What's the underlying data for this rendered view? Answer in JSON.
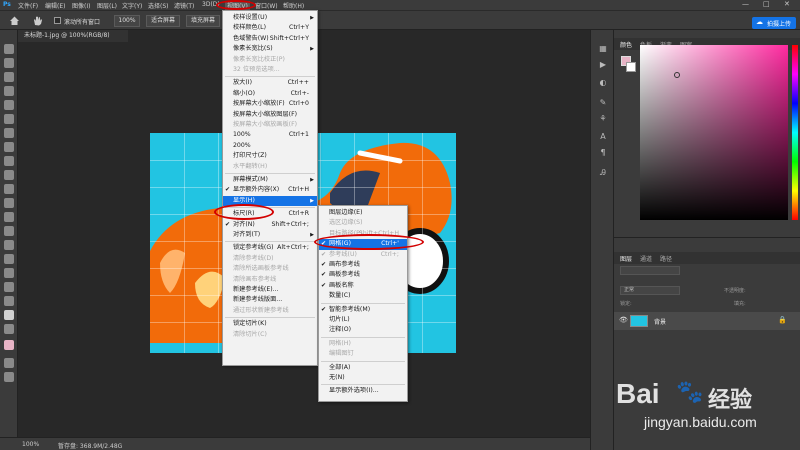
{
  "menubar": {
    "items": [
      "文件(F)",
      "编辑(E)",
      "图像(I)",
      "图层(L)",
      "文字(Y)",
      "选择(S)",
      "滤镜(T)",
      "3D(D)",
      "视图(V)",
      "窗口(W)",
      "帮助(H)"
    ],
    "win_minimize": "—",
    "win_maximize": "□",
    "win_close": "✕"
  },
  "optbar": {
    "scroll_all_label": "滚动所有窗口",
    "zoom_label": "100%",
    "fit_screen_label": "适合屏幕",
    "fill_screen_label": "填充屏幕",
    "cloud_button_label": "拍摄上传"
  },
  "document": {
    "tab_title": "未标题-1.jpg @ 100%(RGB/8)",
    "status_zoom": "100%",
    "status_info": "暂存盘: 368.9M/2.48G"
  },
  "panels": {
    "color_tabs": [
      "颜色",
      "色板",
      "渐变",
      "图案"
    ],
    "learn_tabs": [
      "学习",
      "调整"
    ],
    "layers_tabs": [
      "图层",
      "通道",
      "路径"
    ],
    "blend_mode": "正常",
    "opacity_label": "不透明度:",
    "lock_label": "锁定:",
    "fill_label": "填充:",
    "layer_name": "背景"
  },
  "view_menu": {
    "items": [
      {
        "label": "校样设置(U)",
        "shortcut": "",
        "submenu": true
      },
      {
        "label": "校样颜色(L)",
        "shortcut": "Ctrl+Y"
      },
      {
        "label": "色域警告(W)",
        "shortcut": "Shift+Ctrl+Y"
      },
      {
        "label": "像素长宽比(S)",
        "shortcut": "",
        "submenu": true
      },
      {
        "label": "像素长宽比校正(P)",
        "shortcut": "",
        "disabled": true
      },
      {
        "label": "32 位预览选项...",
        "shortcut": "",
        "disabled": true
      },
      {
        "label": "放大(I)",
        "shortcut": "Ctrl++"
      },
      {
        "label": "缩小(O)",
        "shortcut": "Ctrl+-"
      },
      {
        "label": "按屏幕大小缩放(F)",
        "shortcut": "Ctrl+0"
      },
      {
        "label": "按屏幕大小缩放图层(F)",
        "shortcut": ""
      },
      {
        "label": "按屏幕大小缩放画板(F)",
        "shortcut": "",
        "disabled": true
      },
      {
        "label": "100%",
        "shortcut": "Ctrl+1"
      },
      {
        "label": "200%",
        "shortcut": ""
      },
      {
        "label": "打印尺寸(Z)",
        "shortcut": ""
      },
      {
        "label": "水平翻转(H)",
        "shortcut": "",
        "disabled": true
      },
      {
        "label": "屏幕模式(M)",
        "shortcut": "",
        "submenu": true
      },
      {
        "label": "显示额外内容(X)",
        "shortcut": "Ctrl+H",
        "checked": true
      },
      {
        "label": "显示(H)",
        "shortcut": "",
        "submenu": true,
        "highlight": true
      },
      {
        "label": "标尺(R)",
        "shortcut": "Ctrl+R"
      },
      {
        "label": "对齐(N)",
        "shortcut": "Shift+Ctrl+;",
        "checked": true
      },
      {
        "label": "对齐到(T)",
        "shortcut": "",
        "submenu": true
      },
      {
        "label": "锁定参考线(G)",
        "shortcut": "Alt+Ctrl+;"
      },
      {
        "label": "清除参考线(D)",
        "shortcut": "",
        "disabled": true
      },
      {
        "label": "清除所选画板参考线",
        "shortcut": "",
        "disabled": true
      },
      {
        "label": "清除画布参考线",
        "shortcut": "",
        "disabled": true
      },
      {
        "label": "新建参考线(E)...",
        "shortcut": ""
      },
      {
        "label": "新建参考线版面...",
        "shortcut": ""
      },
      {
        "label": "通过形状新建参考线",
        "shortcut": "",
        "disabled": true
      },
      {
        "label": "锁定切片(K)",
        "shortcut": ""
      },
      {
        "label": "清除切片(C)",
        "shortcut": "",
        "disabled": true
      }
    ]
  },
  "show_submenu": {
    "items": [
      {
        "label": "图层边缘(E)",
        "shortcut": ""
      },
      {
        "label": "选区边缘(S)",
        "shortcut": "",
        "disabled": true
      },
      {
        "label": "目标路径(P)",
        "shortcut": "Shift+Ctrl+H",
        "disabled": true
      },
      {
        "label": "网格(G)",
        "shortcut": "Ctrl+'",
        "checked": true,
        "highlight": true
      },
      {
        "label": "参考线(U)",
        "shortcut": "Ctrl+;",
        "checked": true,
        "disabled": true
      },
      {
        "label": "画布参考线",
        "shortcut": "",
        "checked": true
      },
      {
        "label": "画板参考线",
        "shortcut": "",
        "checked": true
      },
      {
        "label": "画板名称",
        "shortcut": "",
        "checked": true
      },
      {
        "label": "数量(C)",
        "shortcut": ""
      },
      {
        "label": "智能参考线(M)",
        "shortcut": "",
        "checked": true
      },
      {
        "label": "切片(L)",
        "shortcut": ""
      },
      {
        "label": "注释(O)",
        "shortcut": ""
      },
      {
        "label": "网格(H)",
        "shortcut": "",
        "disabled": true
      },
      {
        "label": "编辑图钉",
        "shortcut": "",
        "disabled": true
      },
      {
        "label": "全部(A)",
        "shortcut": ""
      },
      {
        "label": "无(N)",
        "shortcut": ""
      },
      {
        "label": "显示额外选项(I)...",
        "shortcut": ""
      }
    ]
  },
  "watermark": {
    "brand_text": "Bai",
    "brand_text2": "经验",
    "url": "jingyan.baidu.com"
  },
  "colors": {
    "accent": "#1473e6",
    "annotation": "#d20000",
    "canvas_bg": "#22c4e2",
    "car_orange": "#f26b0a"
  }
}
